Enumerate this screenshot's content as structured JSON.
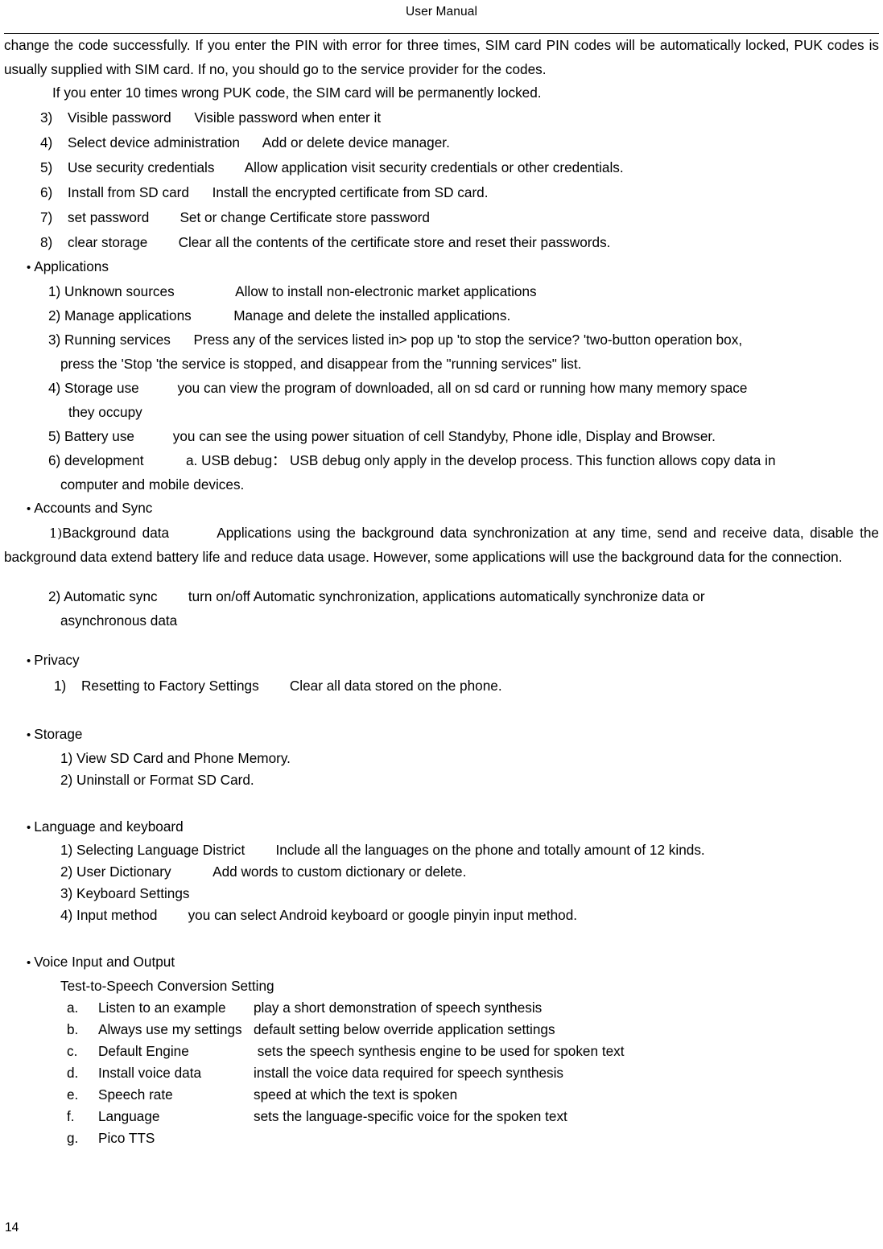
{
  "header": {
    "title": "User Manual"
  },
  "footer": {
    "page_number": "14"
  },
  "body": {
    "intro_paragraph": "change the code successfully. If you enter the PIN with error for three times, SIM card PIN codes will be automatically locked, PUK codes is usually supplied with SIM card. If no, you should go to the service provider for the codes.",
    "intro_second_line": "If you enter 10 times wrong PUK code, the SIM card will be permanently locked.",
    "security_items": [
      {
        "num": "3)",
        "term": "Visible password",
        "desc": "Visible password when enter it"
      },
      {
        "num": "4)",
        "term": "Select device administration",
        "desc": "Add or delete device manager."
      },
      {
        "num": "5)",
        "term": "Use security credentials",
        "desc": "Allow application visit security credentials or other credentials."
      },
      {
        "num": "6)",
        "term": "Install from SD card",
        "desc": "Install the encrypted certificate from SD card."
      },
      {
        "num": "7)",
        "term": "set password",
        "desc": "Set or change Certificate store password"
      },
      {
        "num": "8)",
        "term": "clear storage",
        "desc": "Clear all the contents of the certificate store and reset their passwords."
      }
    ],
    "sections": {
      "applications": {
        "bullet": "•",
        "title": "Applications",
        "item1": "1) Unknown sources                Allow to install non-electronic market applications",
        "item2": "2) Manage applications           Manage and delete the installed applications.",
        "item3_line1": "3) Running services      Press any of the services listed in> pop up 'to stop the service? 'two-button operation box,",
        "item3_line2": "press the 'Stop 'the service is stopped, and disappear from the \"running services\" list.",
        "item4_line1": "4) Storage use          you can view the program of downloaded, all on sd card or running how many memory space",
        "item4_line2": "they occupy",
        "item5": "5) Battery use          you can see the using power situation of cell Standyby, Phone idle, Display and Browser.",
        "item6_line1": "6) development           a. USB debug： USB debug only apply in the develop process. This function allows copy data in",
        "item6_line2": "computer and mobile devices."
      },
      "accounts_and_sync": {
        "bullet": "•",
        "title": "Accounts and Sync",
        "item1_num": "1)",
        "item1_text": "Background data        Applications using the background data synchronization at any time, send and receive data, disable the background data extend battery life and reduce data usage. However, some applications will use the background data for the connection.",
        "item2_line1": "2) Automatic sync        turn on/off Automatic synchronization, applications automatically synchronize data or",
        "item2_line2": "asynchronous data"
      },
      "privacy": {
        "bullet": "•",
        "title": "Privacy",
        "item1_num": "1)",
        "item1_term": "Resetting to Factory Settings",
        "item1_desc": "Clear all data stored on the phone."
      },
      "storage": {
        "bullet": "•",
        "title": "Storage",
        "item1": "1) View SD Card and Phone Memory.",
        "item2": "2) Uninstall or Format SD Card."
      },
      "language_and_keyboard": {
        "bullet": "•",
        "title": "Language and keyboard",
        "item1": "1) Selecting Language District        Include all the languages on the phone and totally amount of 12 kinds.",
        "item2": "2) User Dictionary           Add words to custom dictionary or delete.",
        "item3": "3) Keyboard Settings",
        "item4": "4) Input method        you can select Android keyboard or google pinyin input method."
      },
      "voice_input_output": {
        "bullet": "•",
        "title": "Voice Input and Output",
        "subtitle": "Test-to-Speech Conversion Setting",
        "items": [
          {
            "letter": "a.",
            "term": "Listen to an example",
            "desc": "play a short demonstration of speech synthesis"
          },
          {
            "letter": "b.",
            "term": "Always use my settings",
            "desc": "default setting below override application settings"
          },
          {
            "letter": "c.",
            "term": "Default Engine",
            "desc": " sets the speech synthesis engine to be used for spoken text"
          },
          {
            "letter": "d.",
            "term": "Install voice data",
            "desc": "install the voice data required for speech synthesis"
          },
          {
            "letter": "e.",
            "term": "Speech rate",
            "desc": "speed at which the text is spoken"
          },
          {
            "letter": "f.",
            "term": "Language",
            "desc": "sets the language-specific voice for the spoken text"
          },
          {
            "letter": "g.",
            "term": "Pico TTS",
            "desc": ""
          }
        ]
      }
    }
  }
}
